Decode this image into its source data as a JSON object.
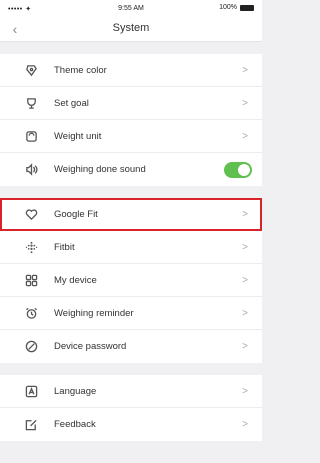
{
  "status_bar": {
    "signal": "••••• ✦",
    "time": "9:55 AM",
    "battery": "100%"
  },
  "nav": {
    "back_icon": "chevron-left-icon",
    "title": "System"
  },
  "group1": [
    {
      "label": "Theme color",
      "icon": "palette-icon"
    },
    {
      "label": "Set goal",
      "icon": "trophy-icon"
    },
    {
      "label": "Weight unit",
      "icon": "scale-icon"
    },
    {
      "label": "Weighing done sound",
      "icon": "speaker-icon",
      "toggle": true
    }
  ],
  "group2": [
    {
      "label": "Google Fit",
      "icon": "heart-icon",
      "highlighted": true
    },
    {
      "label": "Fitbit",
      "icon": "fitbit-icon"
    },
    {
      "label": "My device",
      "icon": "grid-icon"
    },
    {
      "label": "Weighing reminder",
      "icon": "alarm-icon"
    },
    {
      "label": "Device password",
      "icon": "lock-icon"
    }
  ],
  "group3": [
    {
      "label": "Language",
      "icon": "language-icon"
    },
    {
      "label": "Feedback",
      "icon": "edit-icon"
    }
  ],
  "chevron": ">",
  "colors": {
    "toggle_on": "#5fbf4f",
    "highlight": "#d8232a"
  }
}
